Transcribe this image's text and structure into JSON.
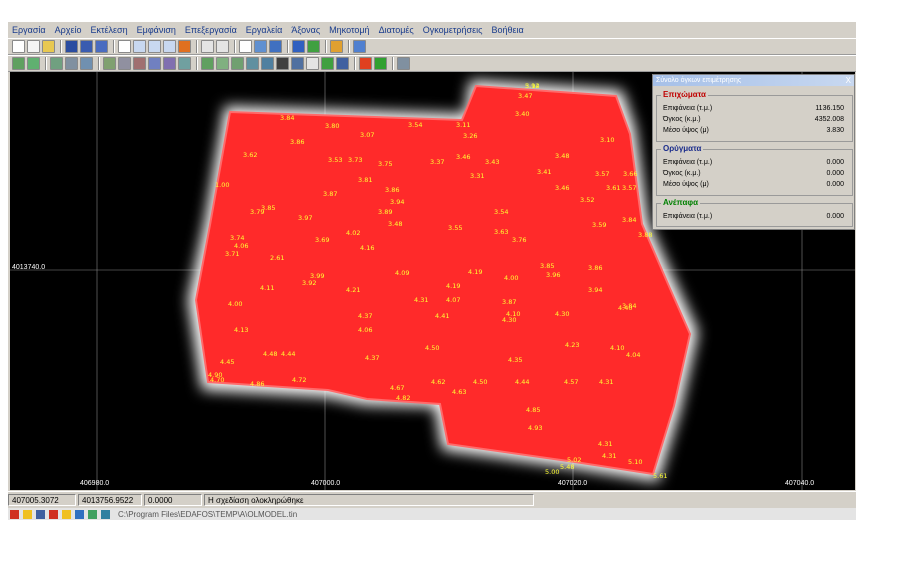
{
  "menu": [
    "Εργασία",
    "Αρχείο",
    "Εκτέλεση",
    "Εμφάνιση",
    "Επεξεργασία",
    "Εργαλεία",
    "Άξονας",
    "Μηκοτομή",
    "Διατομές",
    "Ογκομετρήσεις",
    "Βοήθεια"
  ],
  "panel": {
    "title": "Σύνολο όγκων επιμέτρησης",
    "close": "X",
    "fill": {
      "title": "Επιχώματα",
      "rows": [
        {
          "label": "Επιφάνεια (τ.μ.)",
          "value": "1136.150"
        },
        {
          "label": "Όγκος (κ.μ.)",
          "value": "4352.008"
        },
        {
          "label": "Μέσο ύψος (μ)",
          "value": "3.830"
        }
      ]
    },
    "cut": {
      "title": "Ορύγματα",
      "rows": [
        {
          "label": "Επιφάνεια (τ.μ.)",
          "value": "0.000"
        },
        {
          "label": "Όγκος (κ.μ.)",
          "value": "0.000"
        },
        {
          "label": "Μέσο ύψος (μ)",
          "value": "0.000"
        }
      ]
    },
    "flat": {
      "title": "Ανέπαφα",
      "rows": [
        {
          "label": "Επιφάνεια (τ.μ.)",
          "value": "0.000"
        }
      ]
    }
  },
  "axes": {
    "y_label": "4013740.0",
    "x_labels": [
      "406980.0",
      "407000.0",
      "407020.0",
      "407040.0"
    ]
  },
  "status": {
    "x": "407005.3072",
    "y": "4013756.9522",
    "z": "0.0000",
    "message": "Η σχεδίαση ολοκληρώθηκε"
  },
  "taskbar_path": "C:\\Program Files\\EDAFOS\\TEMP\\A\\OLMODEL.tin",
  "colors": {
    "fill_red": "#ff2a2a",
    "canvas": "#000000",
    "labels": "#ffff33"
  },
  "elevation_labels": [
    "3.94",
    "3.47",
    "3.40",
    "3.84",
    "3.80",
    "3.86",
    "3.07",
    "3.54",
    "3.11",
    "3.26",
    "3.10",
    "3.62",
    "3.53",
    "3.73",
    "3.75",
    "3.37",
    "3.46",
    "3.43",
    "3.48",
    "3.57",
    "3.66",
    "3.81",
    "3.31",
    "3.41",
    "3.61",
    "3.57",
    "1.00",
    "3.87",
    "3.86",
    "3.94",
    "3.46",
    "3.52",
    "3.85",
    "3.79",
    "3.97",
    "3.89",
    "3.54",
    "3.84",
    "3.48",
    "3.55",
    "3.59",
    "4.02",
    "3.63",
    "3.74",
    "3.76",
    "3.88",
    "3.69",
    "4.06",
    "4.16",
    "3.71",
    "3.85",
    "2.61",
    "3.99",
    "4.09",
    "4.19",
    "4.00",
    "3.96",
    "3.86",
    "4.11",
    "3.92",
    "3.94",
    "4.21",
    "4.19",
    "4.31",
    "4.07",
    "3.87",
    "3.84",
    "4.00",
    "4.10",
    "4.30",
    "4.37",
    "4.41",
    "4.13",
    "4.06",
    "4.30",
    "4.40",
    "4.23",
    "4.45",
    "4.48",
    "4.44",
    "4.50",
    "4.10",
    "4.04",
    "4.90",
    "4.37",
    "4.35",
    "4.70",
    "4.72",
    "4.62",
    "4.50",
    "4.44",
    "4.57",
    "4.31",
    "4.86",
    "4.67",
    "4.82",
    "4.63",
    "4.85",
    "4.93",
    "4.31",
    "4.31",
    "5.02",
    "5.00",
    "5.48",
    "5.61",
    "5.10",
    "5.12"
  ]
}
